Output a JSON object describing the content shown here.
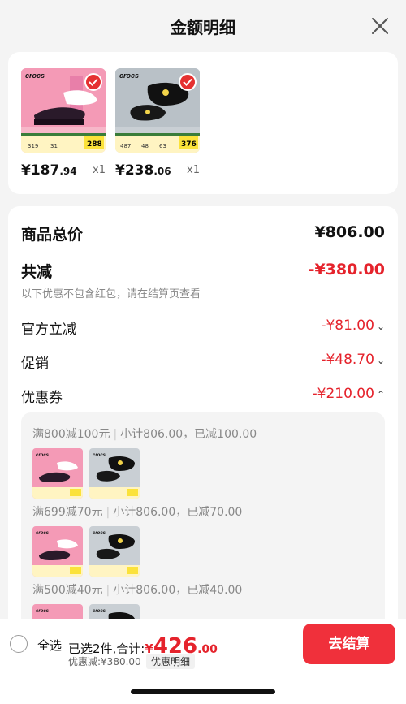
{
  "header": {
    "title": "金额明细",
    "close_icon": "close-icon"
  },
  "products": [
    {
      "brand": "crocs",
      "price_int": "¥187",
      "price_dec": ".94",
      "qty": "x1",
      "selected": true
    },
    {
      "brand": "crocs",
      "price_int": "¥238",
      "price_dec": ".06",
      "qty": "x1",
      "selected": true
    }
  ],
  "summary": {
    "total_label": "商品总价",
    "total_value": "¥806.00",
    "reduce_label": "共减",
    "reduce_value": "-¥380.00",
    "reduce_note": "以下优惠不包含红包，请在结算页查看",
    "official_label": "官方立减",
    "official_value": "-¥81.00",
    "promo_label": "促销",
    "promo_value": "-¥48.70",
    "coupon_label": "优惠券",
    "coupon_value": "-¥210.00"
  },
  "coupons": [
    {
      "rule": "满800减100元",
      "detail": "小计806.00，已减100.00"
    },
    {
      "rule": "满699减70元",
      "detail": "小计806.00，已减70.00"
    },
    {
      "rule": "满500减40元",
      "detail": "小计806.00，已减40.00"
    }
  ],
  "bottom": {
    "select_all": "全选",
    "selected_text": "已选2件,合计:",
    "yen": "¥",
    "amount_int": "426",
    "amount_dec": ".00",
    "discount_text": "优惠减:¥380.00",
    "detail_button": "优惠明细",
    "checkout_button": "去结算"
  },
  "colors": {
    "accent": "#e5232c",
    "checkout": "#f0303b",
    "background": "#f4f4f4"
  }
}
